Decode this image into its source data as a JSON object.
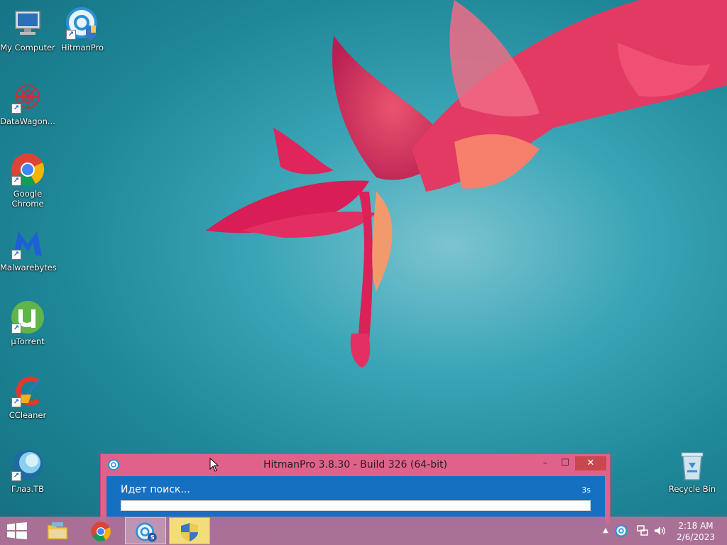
{
  "desktop": {
    "icons": [
      {
        "label": "My Computer",
        "icon": "my-computer-icon"
      },
      {
        "label": "HitmanPro",
        "icon": "hitmanpro-icon"
      },
      {
        "label": "DataWagon...",
        "icon": "datawagon-icon"
      },
      {
        "label": "Google Chrome",
        "icon": "chrome-icon"
      },
      {
        "label": "Malwarebytes",
        "icon": "malwarebytes-icon"
      },
      {
        "label": "µTorrent",
        "icon": "utorrent-icon"
      },
      {
        "label": "CCleaner",
        "icon": "ccleaner-icon"
      },
      {
        "label": "Глаз.ТВ",
        "icon": "glaz-tv-icon"
      },
      {
        "label": "Recycle Bin",
        "icon": "recycle-bin-icon"
      }
    ]
  },
  "hitmanpro_window": {
    "title": "HitmanPro 3.8.30 - Build 326 (64-bit)",
    "status": "Идет поиск...",
    "elapsed": "3s",
    "progress": 1.0,
    "accent": "#1670c2",
    "frame_color": "#e0628b"
  },
  "taskbar": {
    "buttons": [
      {
        "name": "file-explorer",
        "icon": "folder-icon"
      },
      {
        "name": "google-chrome",
        "icon": "chrome-icon"
      },
      {
        "name": "hitmanpro",
        "icon": "hitmanpro-icon",
        "active": true
      },
      {
        "name": "user-account-control",
        "icon": "uac-shield-icon"
      }
    ],
    "tray": [
      "show-hidden-icons-arrow",
      "hitmanpro-tray-icon",
      "network-icon",
      "volume-icon"
    ],
    "clock": {
      "time": "2:18 AM",
      "date": "2/6/2023"
    }
  }
}
